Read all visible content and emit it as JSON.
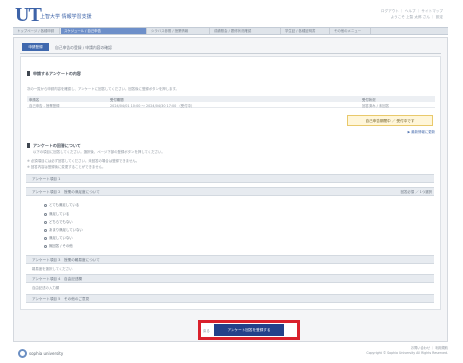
{
  "header": {
    "logo_text": "UT",
    "university_name": "上智大学 情報学習支援",
    "top_links_line1": "ログアウト ｜ ヘルプ ｜ サイトマップ",
    "top_links_line2": "ようこそ 上智 太郎 さん ｜ 設定"
  },
  "nav": {
    "tabs": [
      {
        "label": "トップページ / 各種申請"
      },
      {
        "label": "スケジュール / 自己申告"
      },
      {
        "label": "シラバス参照 / 授業情報"
      },
      {
        "label": "成績照会 / 履修状況確認"
      },
      {
        "label": "学生証 / 各種証明書"
      },
      {
        "label": "その他のメニュー"
      }
    ]
  },
  "subtab": {
    "label": "申請登録"
  },
  "page_title": "自己申告の登録 / 申請内容の確認",
  "section1": {
    "title": "申請するアンケートの内容",
    "desc": "次の一覧から申請内容を確認し、アンケートに回答してください。回答後に登録ボタンを押します。",
    "table_headers": [
      "申請名",
      "受付期間",
      "受付状況"
    ],
    "table_row": [
      "自己申告 - 授業登録",
      "2024/04/01 10:00 ～ 2024/04/30 17:00 （受付中）",
      "回答済み / 未回答"
    ],
    "notice": "自己申告期間中 ／ 受付中です",
    "reload_link": "▶ 最新情報に更新"
  },
  "section2": {
    "title": "アンケートの回答について",
    "desc": "以下の項目に回答してください。選択後、ページ下部の登録ボタンを押してください。",
    "note1": "※ 必須項目には必ず回答してください。未回答の場合は登録できません。",
    "note2": "※ 回答内容は登録後に変更することができません。"
  },
  "bars": {
    "bar1": "アンケート項目 1",
    "bar2": "アンケート項目 2　授業の満足度について",
    "bar2_right": "回答必須 ／ 1つ選択",
    "options": [
      "とても満足している",
      "満足している",
      "どちらでもない",
      "あまり満足していない",
      "満足していない",
      "無回答 / その他"
    ],
    "bar3": "アンケート項目 3　授業の難易度について",
    "bar3_sub": "難易度を選択してください",
    "bar4": "アンケート項目 4　自由記述欄",
    "bar4_sub": "自由記述の入力欄",
    "bar5": "アンケート項目 5　その他のご意見"
  },
  "actions": {
    "back_label": "戻る",
    "submit_label": "アンケート回答を登録する"
  },
  "footer": {
    "brand": "sophia university",
    "right_line1": "お問い合わせ ｜ 利用規約",
    "right_line2": "Copyright © Sophia University All Rights Reserved."
  },
  "colors": {
    "brand_blue": "#3d63a8",
    "button_navy": "#23418a",
    "highlight_red": "#d9212c"
  }
}
